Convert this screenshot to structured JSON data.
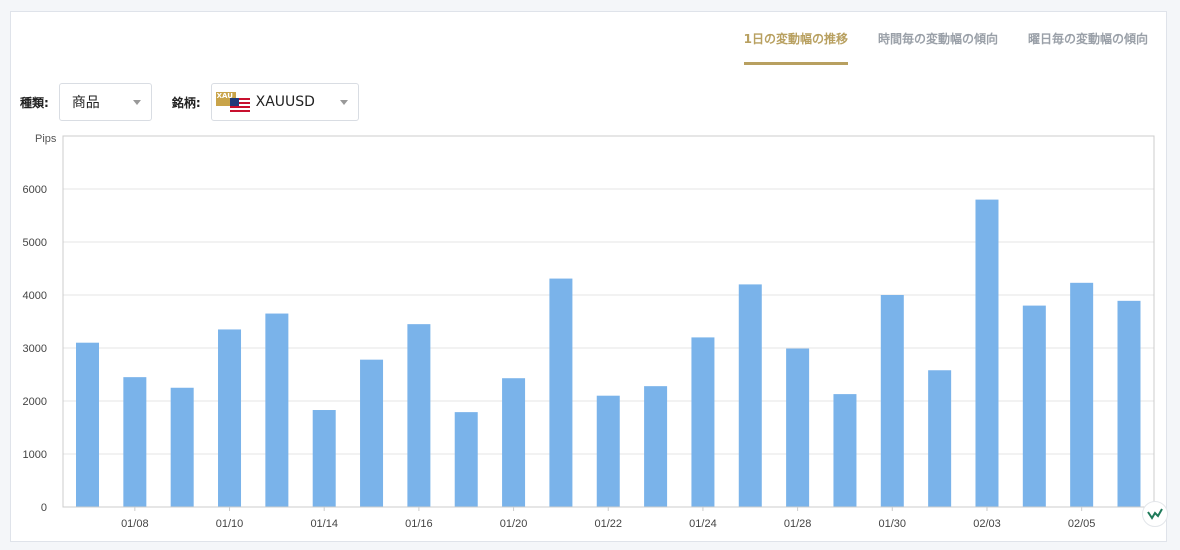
{
  "tabs": [
    {
      "label": "1日の変動幅の推移",
      "active": true
    },
    {
      "label": "時間毎の変動幅の傾向",
      "active": false
    },
    {
      "label": "曜日毎の変動幅の傾向",
      "active": false
    }
  ],
  "filters": {
    "type_label": "種類:",
    "type_value": "商品",
    "symbol_label": "銘柄:",
    "symbol_value": "XAUUSD",
    "symbol_icon_text": "XAU"
  },
  "colors": {
    "bar": "#7ab3ea",
    "accent": "#b8a060",
    "grid": "#e6e6e6"
  },
  "chart_data": {
    "type": "bar",
    "ylabel": "Pips",
    "ylim": [
      0,
      7000
    ],
    "yticks": [
      0,
      1000,
      2000,
      3000,
      4000,
      5000,
      6000
    ],
    "values": [
      3100,
      2450,
      2250,
      3350,
      3650,
      1830,
      2780,
      3450,
      1790,
      2430,
      4310,
      2100,
      2280,
      3200,
      4200,
      2990,
      2130,
      4000,
      2580,
      5800,
      3800,
      4230,
      3890
    ],
    "x_tick_labels": [
      {
        "index": 1,
        "label": "01/08"
      },
      {
        "index": 3,
        "label": "01/10"
      },
      {
        "index": 5,
        "label": "01/14"
      },
      {
        "index": 7,
        "label": "01/16"
      },
      {
        "index": 9,
        "label": "01/20"
      },
      {
        "index": 11,
        "label": "01/22"
      },
      {
        "index": 13,
        "label": "01/24"
      },
      {
        "index": 15,
        "label": "01/28"
      },
      {
        "index": 17,
        "label": "01/30"
      },
      {
        "index": 19,
        "label": "02/03"
      },
      {
        "index": 21,
        "label": "02/05"
      }
    ],
    "grid": true,
    "legend": "none"
  }
}
